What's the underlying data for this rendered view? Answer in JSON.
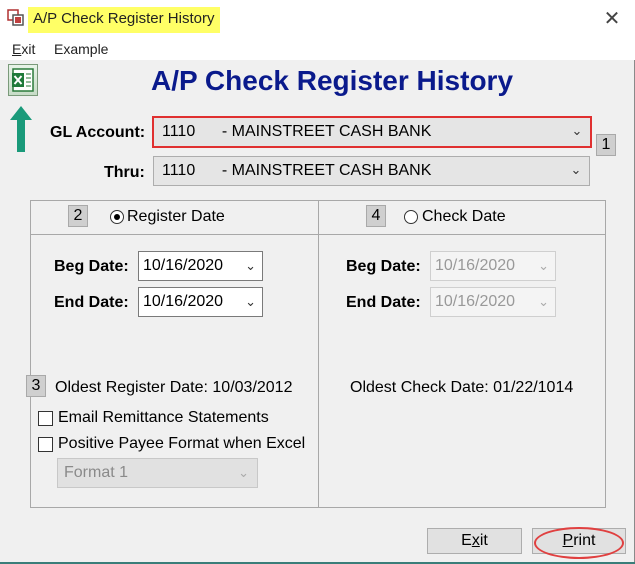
{
  "window": {
    "title": "A/P Check Register History",
    "title_highlight_color": "#ffff66",
    "close_symbol": "✕"
  },
  "menu": {
    "items": [
      {
        "label": "Exit",
        "accel": "E"
      },
      {
        "label": "Example",
        "accel": ""
      }
    ]
  },
  "header": {
    "title": "A/P Check Register History",
    "title_color": "#0a1a8c",
    "excel_icon": "excel-icon"
  },
  "gl_account": {
    "label": "GL Account:",
    "value": "1110      - MAINSTREET CASH BANK",
    "badge": "1"
  },
  "thru": {
    "label": "Thru:",
    "value": "1110      - MAINSTREET CASH BANK"
  },
  "register_panel": {
    "badge": "2",
    "radio_label": "Register Date",
    "selected": true,
    "beg_label": "Beg Date:",
    "beg_value": "10/16/2020",
    "end_label": "End Date:",
    "end_value": "10/16/2020",
    "oldest_badge": "3",
    "oldest_text": "Oldest Register Date: 10/03/2012",
    "email_label": "Email Remittance Statements",
    "positive_label": "Positive Payee Format when Excel",
    "format_value": "Format 1"
  },
  "check_panel": {
    "badge": "4",
    "radio_label": "Check Date",
    "selected": false,
    "beg_label": "Beg Date:",
    "beg_value": "10/16/2020",
    "end_label": "End Date:",
    "end_value": "10/16/2020",
    "oldest_text": "Oldest Check Date: 01/22/1014"
  },
  "buttons": {
    "exit": {
      "pre": "E",
      "accel": "x",
      "post": "it"
    },
    "print": {
      "pre": "",
      "accel": "P",
      "post": "rint"
    }
  },
  "colors": {
    "annotation_red": "#e03030",
    "arrow_teal": "#1a9a7a"
  }
}
